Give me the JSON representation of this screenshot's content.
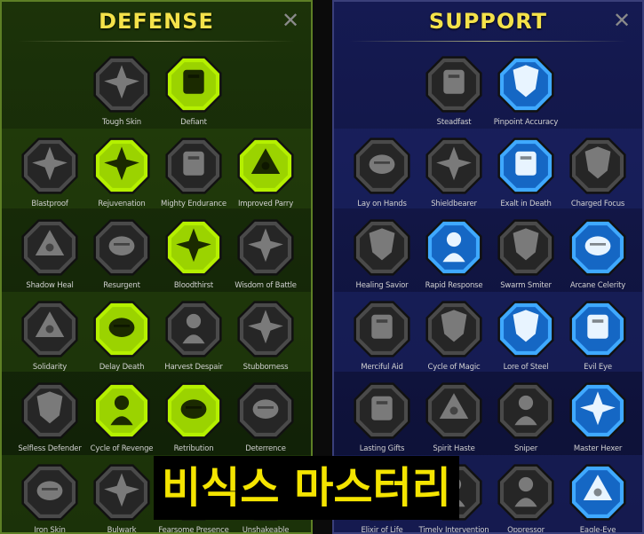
{
  "panels": {
    "defense": {
      "title": "DEFENSE",
      "close": "✕",
      "rows": [
        [
          {
            "label": "Tough Skin",
            "state": "owned",
            "icon": "tough-skin-icon"
          },
          {
            "label": "Defiant",
            "state": "active",
            "icon": "defiant-icon"
          }
        ],
        [
          {
            "label": "Blastproof",
            "state": "owned",
            "icon": "blastproof-icon"
          },
          {
            "label": "Rejuvenation",
            "state": "active",
            "icon": "rejuvenation-icon"
          },
          {
            "label": "Mighty Endurance",
            "state": "owned",
            "icon": "mighty-endurance-icon"
          },
          {
            "label": "Improved Parry",
            "state": "active",
            "icon": "improved-parry-icon"
          }
        ],
        [
          {
            "label": "Shadow Heal",
            "state": "owned",
            "icon": "shadow-heal-icon"
          },
          {
            "label": "Resurgent",
            "state": "owned",
            "icon": "resurgent-icon"
          },
          {
            "label": "Bloodthirst",
            "state": "active",
            "icon": "bloodthirst-icon"
          },
          {
            "label": "Wisdom of Battle",
            "state": "owned",
            "icon": "wisdom-of-battle-icon"
          }
        ],
        [
          {
            "label": "Solidarity",
            "state": "owned",
            "icon": "solidarity-icon"
          },
          {
            "label": "Delay Death",
            "state": "active",
            "icon": "delay-death-icon"
          },
          {
            "label": "Harvest Despair",
            "state": "owned",
            "icon": "harvest-despair-icon"
          },
          {
            "label": "Stubborness",
            "state": "owned",
            "icon": "stubborness-icon"
          }
        ],
        [
          {
            "label": "Selfless Defender",
            "state": "owned",
            "icon": "selfless-defender-icon"
          },
          {
            "label": "Cycle of Revenge",
            "state": "active",
            "icon": "cycle-of-revenge-icon"
          },
          {
            "label": "Retribution",
            "state": "active",
            "icon": "retribution-icon"
          },
          {
            "label": "Deterrence",
            "state": "owned",
            "icon": "deterrence-icon"
          }
        ],
        [
          {
            "label": "Iron Skin",
            "state": "owned",
            "icon": "iron-skin-icon"
          },
          {
            "label": "Bulwark",
            "state": "owned",
            "icon": "bulwark-icon"
          },
          {
            "label": "Fearsome Presence",
            "state": "owned",
            "icon": "fearsome-presence-icon"
          },
          {
            "label": "Unshakeable",
            "state": "owned",
            "icon": "unshakeable-icon"
          }
        ]
      ]
    },
    "support": {
      "title": "SUPPORT",
      "close": "✕",
      "rows": [
        [
          {
            "label": "Steadfast",
            "state": "owned",
            "icon": "steadfast-icon"
          },
          {
            "label": "Pinpoint Accuracy",
            "state": "active",
            "icon": "pinpoint-accuracy-icon"
          }
        ],
        [
          {
            "label": "Lay on Hands",
            "state": "owned",
            "icon": "lay-on-hands-icon"
          },
          {
            "label": "Shieldbearer",
            "state": "owned",
            "icon": "shieldbearer-icon"
          },
          {
            "label": "Exalt in Death",
            "state": "active",
            "icon": "exalt-in-death-icon"
          },
          {
            "label": "Charged Focus",
            "state": "owned",
            "icon": "charged-focus-icon"
          }
        ],
        [
          {
            "label": "Healing Savior",
            "state": "owned",
            "icon": "healing-savior-icon"
          },
          {
            "label": "Rapid Response",
            "state": "active",
            "icon": "rapid-response-icon"
          },
          {
            "label": "Swarm Smiter",
            "state": "owned",
            "icon": "swarm-smiter-icon"
          },
          {
            "label": "Arcane Celerity",
            "state": "active",
            "icon": "arcane-celerity-icon"
          }
        ],
        [
          {
            "label": "Merciful Aid",
            "state": "owned",
            "icon": "merciful-aid-icon"
          },
          {
            "label": "Cycle of Magic",
            "state": "owned",
            "icon": "cycle-of-magic-icon"
          },
          {
            "label": "Lore of Steel",
            "state": "active",
            "icon": "lore-of-steel-icon"
          },
          {
            "label": "Evil Eye",
            "state": "active",
            "icon": "evil-eye-icon"
          }
        ],
        [
          {
            "label": "Lasting Gifts",
            "state": "owned",
            "icon": "lasting-gifts-icon"
          },
          {
            "label": "Spirit Haste",
            "state": "owned",
            "icon": "spirit-haste-icon"
          },
          {
            "label": "Sniper",
            "state": "owned",
            "icon": "sniper-icon"
          },
          {
            "label": "Master Hexer",
            "state": "active",
            "icon": "master-hexer-icon"
          }
        ],
        [
          {
            "label": "Elixir of Life",
            "state": "owned",
            "icon": "elixir-of-life-icon"
          },
          {
            "label": "Timely Intervention",
            "state": "owned",
            "icon": "timely-intervention-icon"
          },
          {
            "label": "Oppressor",
            "state": "owned",
            "icon": "oppressor-icon"
          },
          {
            "label": "Eagle-Eye",
            "state": "active",
            "icon": "eagle-eye-icon"
          }
        ]
      ]
    }
  },
  "caption": "비식스 마스터리",
  "colors": {
    "defense_active": "#b5f000",
    "support_active": "#3fa9ff",
    "title_yellow": "#f4e24a",
    "caption_yellow": "#f4e400"
  }
}
